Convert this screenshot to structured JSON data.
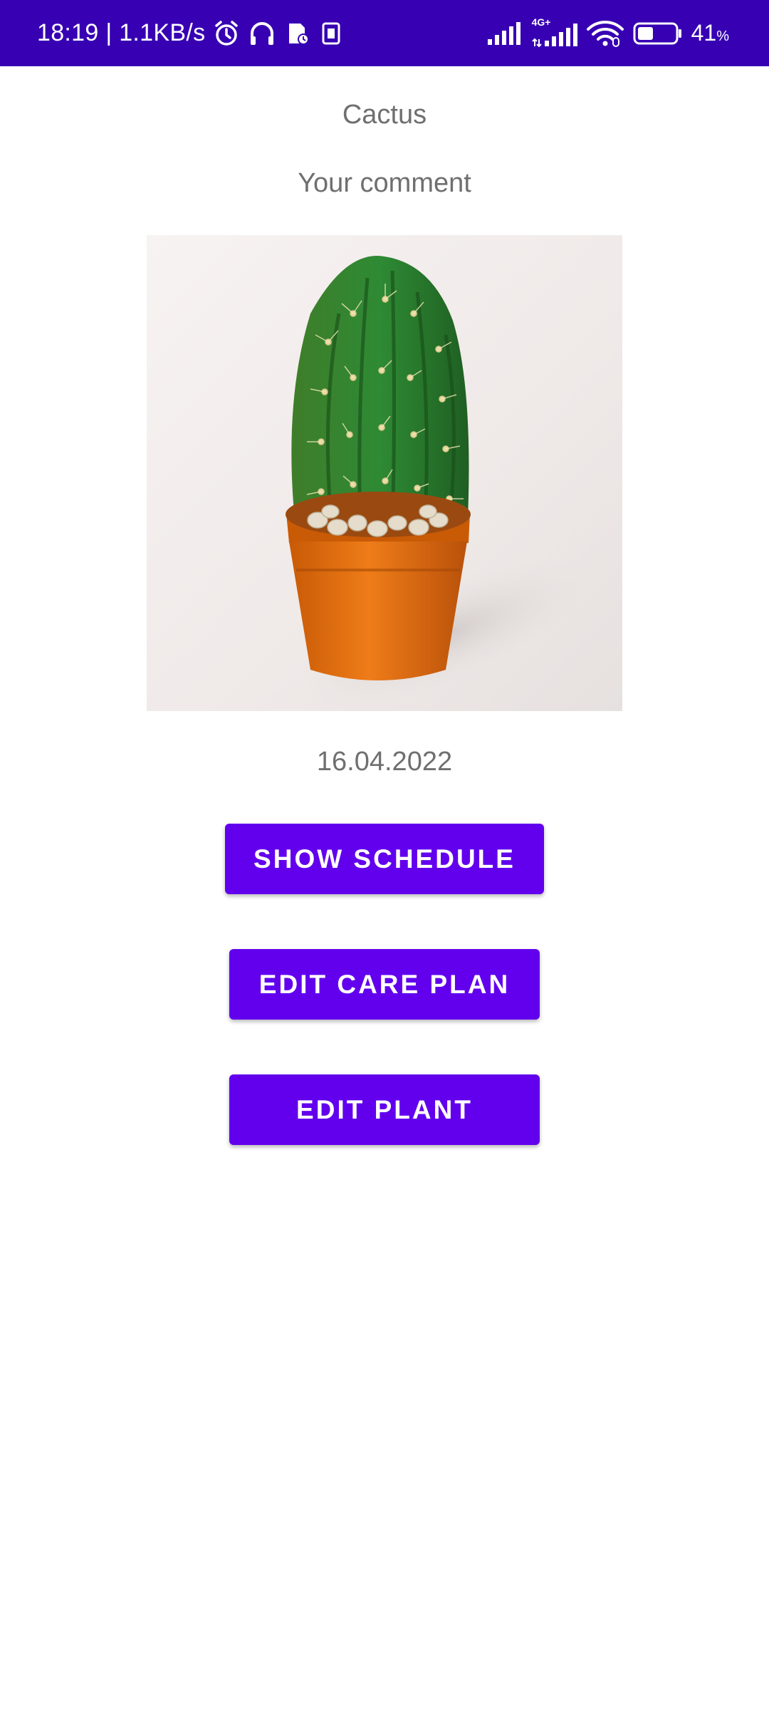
{
  "status_bar": {
    "time_speed": "18:19 | 1.1KB/s",
    "network_label": "4G+",
    "battery_percent": "41",
    "battery_unit": "%",
    "battery_level": 0.41,
    "icons": [
      "alarm-icon",
      "headphones-icon",
      "app-notification-icon",
      "sim-card-icon",
      "signal-icon",
      "signal-4g-icon",
      "wifi-icon",
      "battery-icon"
    ],
    "colors": {
      "background": "#3700b3",
      "foreground": "#ffffff"
    }
  },
  "plant": {
    "name": "Cactus",
    "comment": "Your comment",
    "date": "16.04.2022",
    "image_icon": "potted-cactus-photo"
  },
  "actions": {
    "show_schedule": "SHOW SCHEDULE",
    "edit_care_plan": "EDIT CARE PLAN",
    "edit_plant": "EDIT PLANT"
  },
  "colors": {
    "button": "#6200ee",
    "secondary_text": "#6f6f6f",
    "background": "#ffffff"
  }
}
